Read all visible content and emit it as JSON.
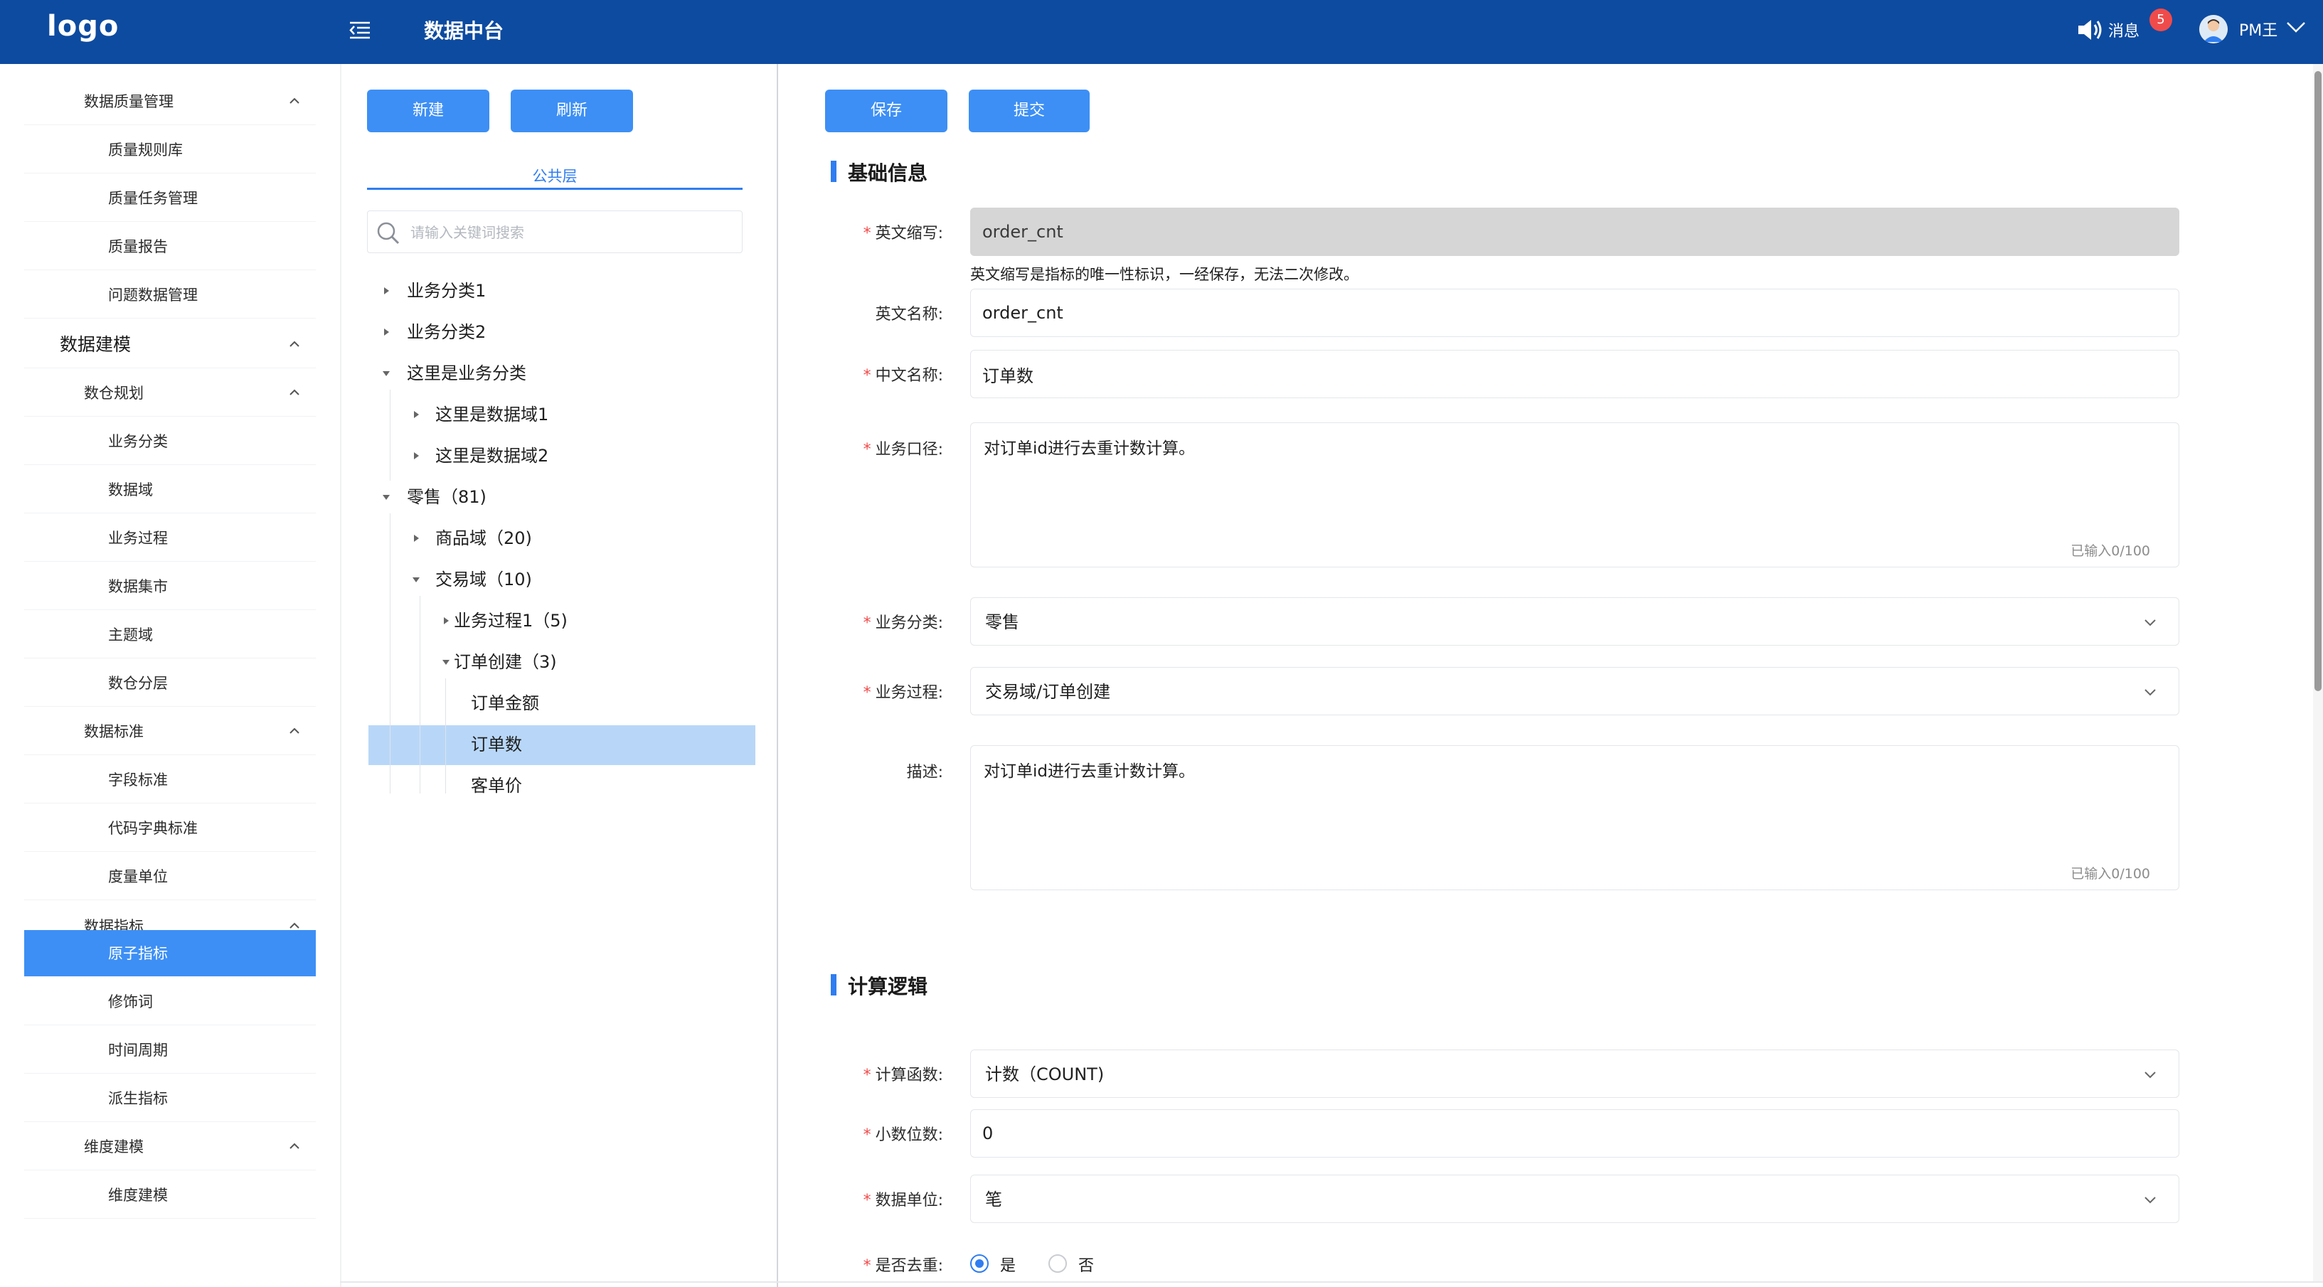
{
  "header": {
    "logo": "logo",
    "app_title": "数据中台",
    "messages_label": "消息",
    "messages_badge": "5",
    "user_name": "PM王"
  },
  "sidebar": {
    "items": [
      {
        "label": "数据质量管理",
        "level": 2,
        "expanded": true
      },
      {
        "label": "质量规则库",
        "level": 3
      },
      {
        "label": "质量任务管理",
        "level": 3
      },
      {
        "label": "质量报告",
        "level": 3
      },
      {
        "label": "问题数据管理",
        "level": 3
      },
      {
        "label": "数据建模",
        "level": 1,
        "expanded": true
      },
      {
        "label": "数仓规划",
        "level": 2,
        "expanded": true
      },
      {
        "label": "业务分类",
        "level": 3
      },
      {
        "label": "数据域",
        "level": 3
      },
      {
        "label": "业务过程",
        "level": 3
      },
      {
        "label": "数据集市",
        "level": 3
      },
      {
        "label": "主题域",
        "level": 3
      },
      {
        "label": "数仓分层",
        "level": 3
      },
      {
        "label": "数据标准",
        "level": 2,
        "expanded": true
      },
      {
        "label": "字段标准",
        "level": 3
      },
      {
        "label": "代码字典标准",
        "level": 3
      },
      {
        "label": "度量单位",
        "level": 3
      },
      {
        "label": "数据指标",
        "level": 2,
        "expanded": true
      },
      {
        "label": "原子指标",
        "level": 3,
        "active": true
      },
      {
        "label": "修饰词",
        "level": 3
      },
      {
        "label": "时间周期",
        "level": 3
      },
      {
        "label": "派生指标",
        "level": 3
      },
      {
        "label": "维度建模",
        "level": 2,
        "expanded": true
      },
      {
        "label": "维度建模",
        "level": 3
      }
    ]
  },
  "tree_panel": {
    "new_button": "新建",
    "refresh_button": "刷新",
    "tab_label": "公共层",
    "search_placeholder": "请输入关键词搜索",
    "nodes": [
      {
        "label": "业务分类1",
        "arrow": "right"
      },
      {
        "label": "业务分类2",
        "arrow": "right"
      },
      {
        "label": "这里是业务分类",
        "arrow": "down"
      },
      {
        "label": "这里是数据域1",
        "arrow": "right"
      },
      {
        "label": "这里是数据域2",
        "arrow": "right"
      },
      {
        "label": "零售（81)",
        "arrow": "down"
      },
      {
        "label": "商品域（20)",
        "arrow": "right"
      },
      {
        "label": "交易域（10)",
        "arrow": "down"
      },
      {
        "label": "业务过程1（5)",
        "arrow": "right"
      },
      {
        "label": "订单创建（3)",
        "arrow": "down"
      },
      {
        "label": "订单金额",
        "arrow": "none"
      },
      {
        "label": "订单数",
        "arrow": "none",
        "selected": true
      },
      {
        "label": "客单价",
        "arrow": "none"
      }
    ]
  },
  "form": {
    "save_button": "保存",
    "submit_button": "提交",
    "section_basic": "基础信息",
    "section_calc": "计算逻辑",
    "en_abbr_label": "英文缩写:",
    "en_abbr_value": "order_cnt",
    "en_abbr_hint": "英文缩写是指标的唯一性标识，一经保存，无法二次修改。",
    "en_name_label": "英文名称:",
    "en_name_value": "order_cnt",
    "cn_name_label": "中文名称:",
    "cn_name_value": "订单数",
    "caliber_label": "业务口径:",
    "caliber_value": "对订单id进行去重计数计算。",
    "caliber_counter": "已输入0/100",
    "category_label": "业务分类:",
    "category_value": "零售",
    "process_label": "业务过程:",
    "process_value": "交易域/订单创建",
    "desc_label": "描述:",
    "desc_value": "对订单id进行去重计数计算。",
    "desc_counter": "已输入0/100",
    "func_label": "计算函数:",
    "func_value": "计数（COUNT)",
    "decimal_label": "小数位数:",
    "decimal_value": "0",
    "unit_label": "数据单位:",
    "unit_value": "笔",
    "dedup_label": "是否去重:",
    "dedup_yes": "是",
    "dedup_no": "否",
    "dedup_selected": "是"
  },
  "colors": {
    "header_bg": "#0d4ba0",
    "primary": "#3d8ff5",
    "accent": "#2f7df0",
    "selected_row": "#b8d7f8",
    "required": "#f04b4b"
  }
}
